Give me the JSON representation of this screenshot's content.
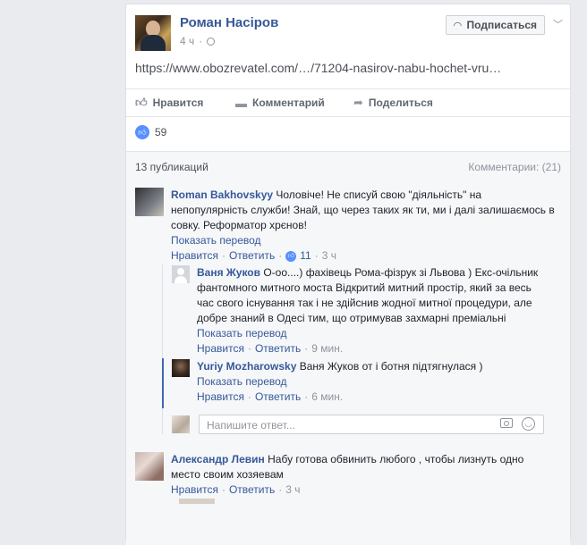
{
  "post": {
    "author": "Роман Насіров",
    "time": "4 ч",
    "subscribe_label": "Подписаться",
    "link": "https://www.obozrevatel.com/…/71204-nasirov-nabu-hochet-vru…",
    "actions": {
      "like": "Нравится",
      "comment": "Комментарий",
      "share": "Поделиться"
    },
    "reactions_count": "59"
  },
  "comments_meta": {
    "publications": "13 публикаций",
    "comments": "Комментарии: (21)"
  },
  "comments": [
    {
      "name": "Roman Bakhovskyy",
      "text": "Чоловіче! Не списуй свою \"діяльність\" на непопулярність служби! Знай, що через таких як ти, ми і далі залишаємось в совку. Реформатор хрєнов!",
      "translate": "Показать перевод",
      "like": "Нравится",
      "reply": "Ответить",
      "likes": "11",
      "time": "3 ч"
    },
    {
      "name": "Ваня Жуков",
      "text": "О-оо....) фахівець Рома-фізрук зі Львова ) Екс-очільник фантомного митного моста Відкритий митний простір, який за весь час свого існування так і не здійснив жодної митної процедури, але добре знаний в Одесі тим, що отримував захмарні преміальні",
      "translate": "Показать перевод",
      "like": "Нравится",
      "reply": "Ответить",
      "time": "9 мин."
    },
    {
      "name": "Yuriy Mozharowsky",
      "text": "Ваня Жуков от і ботня підтягнулася )",
      "translate": "Показать перевод",
      "like": "Нравится",
      "reply": "Ответить",
      "time": "6 мин."
    },
    {
      "name": "Александр Левин",
      "text": "Набу готова обвинить любого , чтобы лизнуть одно место своим хозяевам",
      "like": "Нравится",
      "reply": "Ответить",
      "time": "3 ч"
    }
  ],
  "reply_box": {
    "placeholder": "Напишите ответ..."
  },
  "icons": {
    "subscribe": "rss-icon",
    "menu": "chevron-down-icon",
    "privacy": "globe-icon",
    "like": "thumbs-up-icon",
    "comment": "comment-icon",
    "share": "share-arrow-icon",
    "camera": "camera-icon",
    "emoji": "smile-icon"
  },
  "colors": {
    "link": "#365899",
    "like_blue": "#5890ff",
    "thread_blue": "#4267b2"
  }
}
